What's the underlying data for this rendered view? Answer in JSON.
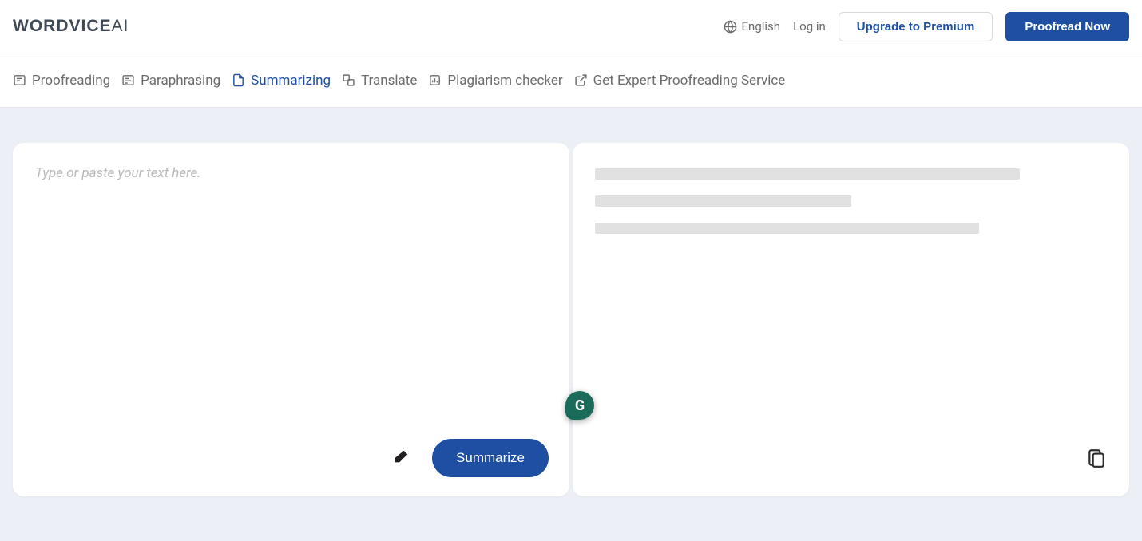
{
  "header": {
    "logo_main": "WORDVICE",
    "logo_suffix": "AI",
    "language": "English",
    "login": "Log in",
    "upgrade": "Upgrade to Premium",
    "proofread": "Proofread Now"
  },
  "tabs": {
    "proofreading": "Proofreading",
    "paraphrasing": "Paraphrasing",
    "summarizing": "Summarizing",
    "translate": "Translate",
    "plagiarism": "Plagiarism checker",
    "expert": "Get Expert Proofreading Service"
  },
  "editor": {
    "placeholder": "Type or paste your text here.",
    "summarize_button": "Summarize"
  },
  "widgets": {
    "grammarly": "G"
  }
}
